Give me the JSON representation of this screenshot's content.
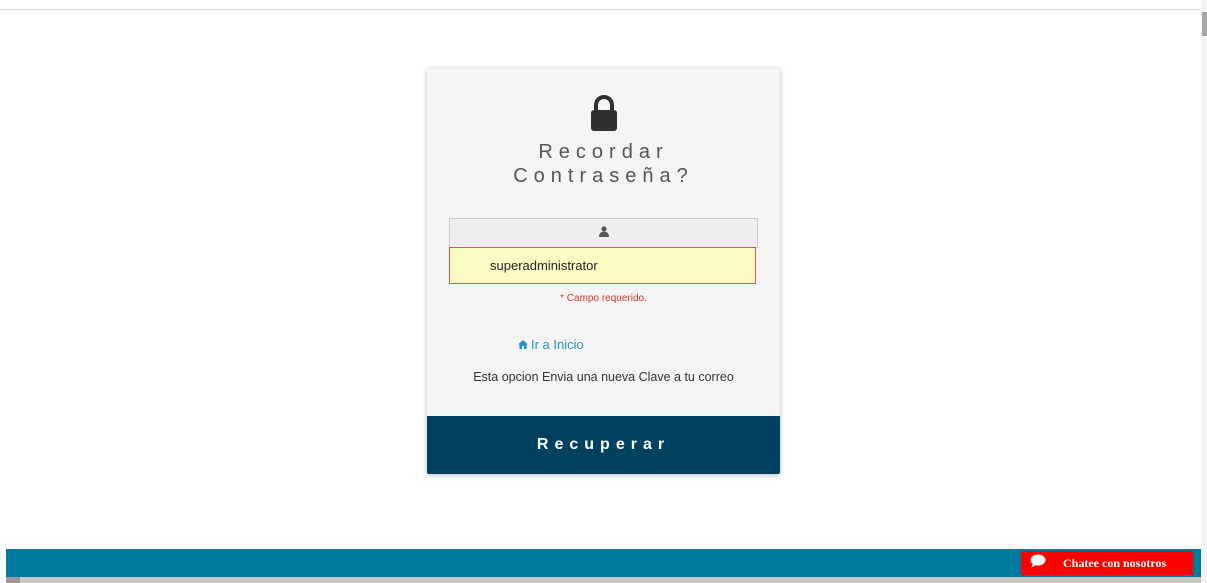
{
  "recover": {
    "title_line1": "Recordar",
    "title_line2": "Contraseña?",
    "username_value": "superadministrator",
    "required_msg": "* Campo requerido.",
    "home_link": "Ir a Inicio",
    "info_text": "Esta opcion Envia una nueva Clave a tu correo",
    "submit_label": "Recuperar"
  },
  "chat": {
    "label": "Chatee con nosotros"
  },
  "icons": {
    "lock": "lock-icon",
    "user": "user-icon",
    "home": "home-icon",
    "chat": "chat-bubble-icon"
  },
  "colors": {
    "button_bg": "#004161",
    "footer_bg": "#00799e",
    "chat_bg": "#ff0000",
    "link": "#2a8fbd",
    "error": "#d9372f",
    "input_bg": "#fbfcc4"
  }
}
